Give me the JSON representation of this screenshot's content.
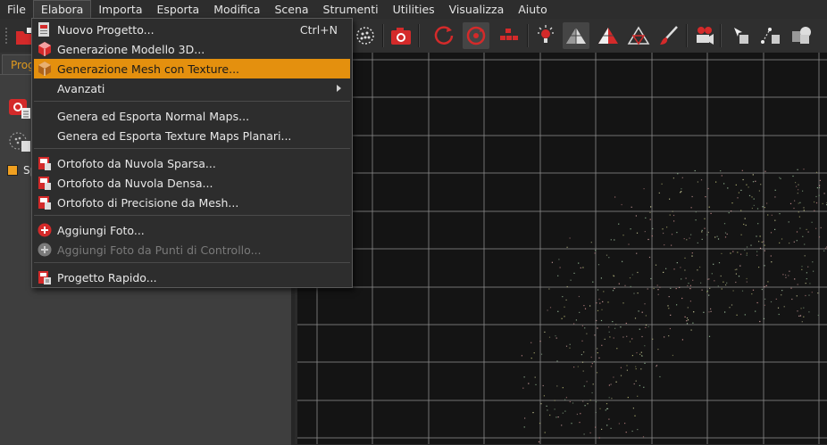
{
  "menubar": {
    "items": [
      "File",
      "Elabora",
      "Importa",
      "Esporta",
      "Modifica",
      "Scena",
      "Strumenti",
      "Utilities",
      "Visualizza",
      "Aiuto"
    ],
    "active_item": "Elabora"
  },
  "left_panel": {
    "tab_label": "Progetto",
    "tree_item_label": "Sparsa"
  },
  "dropdown": {
    "items": [
      {
        "label": "Nuovo Progetto...",
        "shortcut": "Ctrl+N",
        "icon": "new-project-icon"
      },
      {
        "label": "Generazione Modello 3D...",
        "icon": "3d-model-icon"
      },
      {
        "label": "Generazione Mesh con Texture...",
        "icon": "textured-mesh-icon",
        "highlighted": true
      },
      {
        "label": "Avanzati",
        "submenu": true
      },
      {
        "label": "Genera ed Esporta Normal Maps..."
      },
      {
        "label": "Genera ed Esporta Texture Maps Planari..."
      },
      {
        "label": "Ortofoto da Nuvola Sparsa...",
        "icon": "orthophoto-icon"
      },
      {
        "label": "Ortofoto da Nuvola Densa...",
        "icon": "orthophoto-icon"
      },
      {
        "label": "Ortofoto di Precisione da Mesh...",
        "icon": "orthophoto-icon"
      },
      {
        "label": "Aggiungi Foto...",
        "icon": "add-icon"
      },
      {
        "label": "Aggiungi Foto da Punti di Controllo...",
        "icon": "add-icon",
        "disabled": true
      },
      {
        "label": "Progetto Rapido...",
        "icon": "quick-project-icon"
      }
    ]
  },
  "colors": {
    "highlight": "#e4900e",
    "accent_red": "#d42a2a",
    "viewport_bg": "#141414",
    "grid": "#8a8a8a"
  }
}
